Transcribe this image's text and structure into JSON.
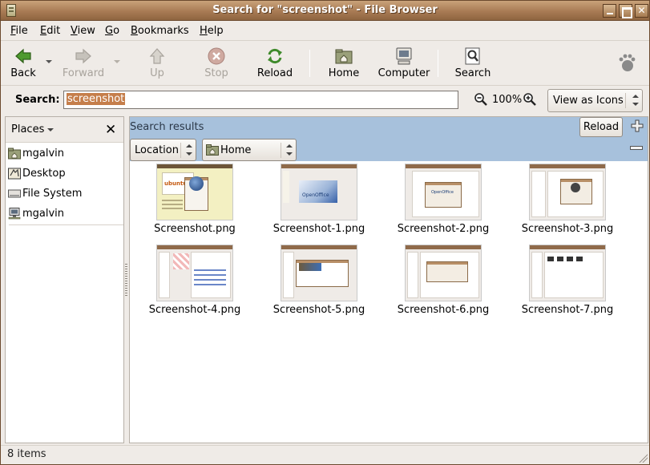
{
  "window": {
    "title": "Search for \"screenshot\" - File Browser"
  },
  "menubar": {
    "items": [
      {
        "first": "F",
        "rest": "ile"
      },
      {
        "first": "E",
        "rest": "dit"
      },
      {
        "first": "V",
        "rest": "iew"
      },
      {
        "first": "G",
        "rest": "o"
      },
      {
        "first": "B",
        "rest": "ookmarks"
      },
      {
        "first": "H",
        "rest": "elp"
      }
    ]
  },
  "toolbar": {
    "back": "Back",
    "forward": "Forward",
    "up": "Up",
    "stop": "Stop",
    "reload": "Reload",
    "home": "Home",
    "computer": "Computer",
    "search": "Search"
  },
  "search": {
    "label": "Search:",
    "value": "screenshot",
    "zoom": "100%",
    "view_mode": "View as Icons"
  },
  "sidebar": {
    "title": "Places",
    "items": [
      {
        "label": "mgalvin",
        "icon": "home-folder-icon"
      },
      {
        "label": "Desktop",
        "icon": "desktop-icon"
      },
      {
        "label": "File System",
        "icon": "drive-icon"
      },
      {
        "label": "mgalvin",
        "icon": "network-icon"
      }
    ]
  },
  "results": {
    "title": "Search results",
    "reload": "Reload",
    "criterion": "Location",
    "location": "Home",
    "files": [
      "Screenshot.png",
      "Screenshot-1.png",
      "Screenshot-2.png",
      "Screenshot-3.png",
      "Screenshot-4.png",
      "Screenshot-5.png",
      "Screenshot-6.png",
      "Screenshot-7.png"
    ]
  },
  "status": {
    "text": "8 items"
  },
  "colors": {
    "titlebar": "#a87b54",
    "results_bar": "#a7c1dc",
    "selection": "#c57e4b"
  }
}
